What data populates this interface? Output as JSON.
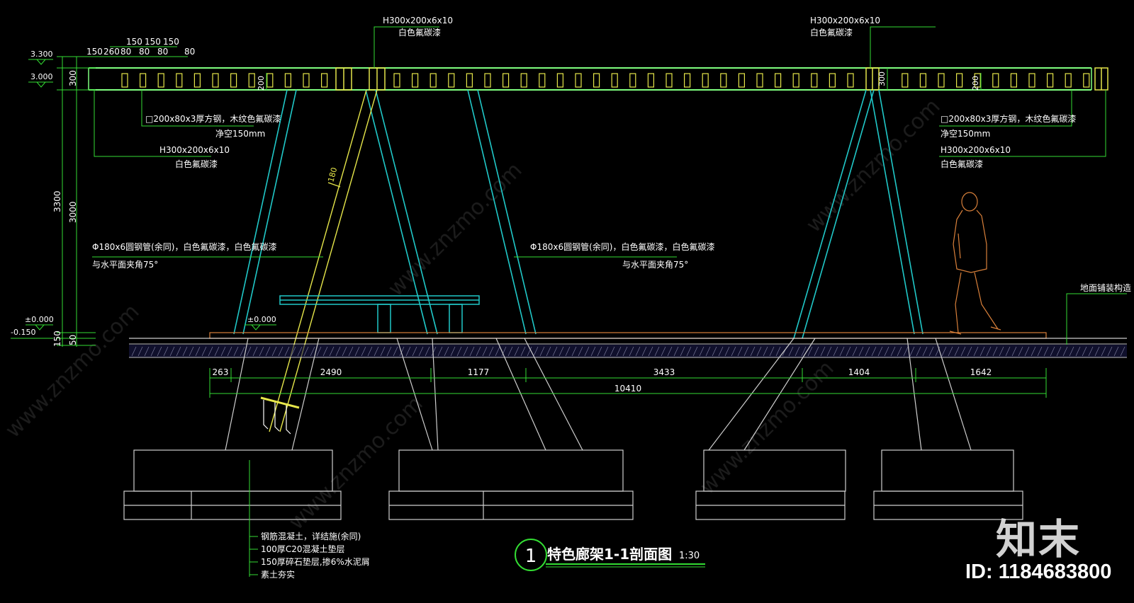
{
  "level_marks": {
    "top": "3.300",
    "beam_base": "3.000",
    "ground": "±0.000",
    "ground_mid": "±0.000",
    "below": "-0.150"
  },
  "left_vertical_dims": {
    "d300": "300",
    "d3000": "3000",
    "d3300": "3300",
    "d150": "150",
    "d50": "50"
  },
  "top_spacing_dims": {
    "row1": [
      "150",
      "260",
      "80",
      "80",
      "80",
      "80"
    ],
    "row2": [
      "150",
      "150",
      "150"
    ]
  },
  "beam_dims": {
    "left_200": "200",
    "right_200": "200",
    "right_300": "300",
    "pipe_180": "180"
  },
  "callouts": {
    "h_beam_spec": "H300x200x6x10",
    "white_paint": "白色氟碳漆",
    "square_tube": "□200x80x3厚方钢，木纹色氟碳漆",
    "clearance": "净空150mm",
    "pipe_spec": "Φ180x6圆钢管(余同)，白色氟碳漆，白色氟碳漆",
    "pipe_angle": "与水平面夹角75°",
    "paving": "地面铺装构造"
  },
  "foundation_notes": [
    "钢筋混凝土，详结施(余同)",
    "100厚C20混凝土垫层",
    "150厚碎石垫层,掺6%水泥屑",
    "素土夯实"
  ],
  "bottom_dims": [
    "263",
    "2490",
    "1177",
    "3433",
    "1404",
    "1642"
  ],
  "total_dim": "10410",
  "title": {
    "number": "1",
    "text": "特色廊架1-1剖面图",
    "scale": "1:30"
  },
  "watermark": {
    "logo": "知末",
    "id": "ID: 1184683800",
    "diagonal": "www.znzmo.com"
  },
  "colors": {
    "background": "#000000",
    "beam_green": "#7fff7f",
    "slat_yellow": "#e6e64a",
    "member_cyan": "#20c8c8",
    "dim_green": "#33dd33",
    "text_white": "#ffffff",
    "person_orange": "#d9803a",
    "foundation_gray": "#cfcfcf"
  }
}
